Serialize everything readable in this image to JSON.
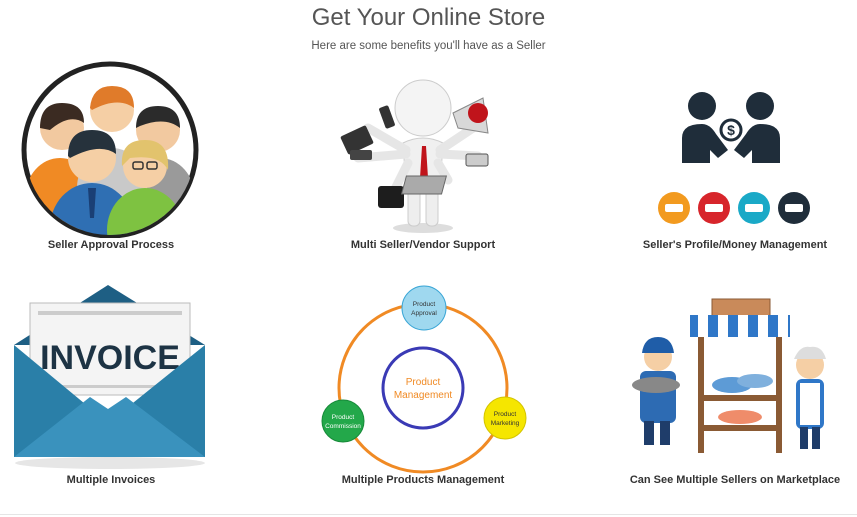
{
  "header": {
    "title": "Get Your Online Store",
    "subtitle": "Here are some benefits you'll have as a Seller"
  },
  "features": [
    {
      "caption": "Seller Approval Process",
      "icon": "team-icon"
    },
    {
      "caption": "Multi Seller/Vendor Support",
      "icon": "multitask-person-icon"
    },
    {
      "caption": "Seller's Profile/Money Management",
      "icon": "handshake-money-icon"
    },
    {
      "caption": "Multiple Invoices",
      "icon": "invoice-envelope-icon"
    },
    {
      "caption": "Multiple Products Management",
      "icon": "product-cycle-diagram"
    },
    {
      "caption": "Can See Multiple Sellers on Marketplace",
      "icon": "market-stall-icon"
    }
  ],
  "cycle": {
    "center": "Product\nManagement",
    "center_line1": "Product",
    "center_line2": "Management",
    "approval_line1": "Product",
    "approval_line2": "Approval",
    "marketing_line1": "Product",
    "marketing_line2": "Marketing",
    "commission_line1": "Product",
    "commission_line2": "Commission"
  },
  "invoice_word": "INVOICE",
  "colors": {
    "orange": "#f08a24",
    "blue_ring": "#3a3ab5",
    "approval": "#9fd8ef",
    "marketing": "#f5e600",
    "commission": "#23a84a",
    "envelope": "#2a7fa8"
  }
}
